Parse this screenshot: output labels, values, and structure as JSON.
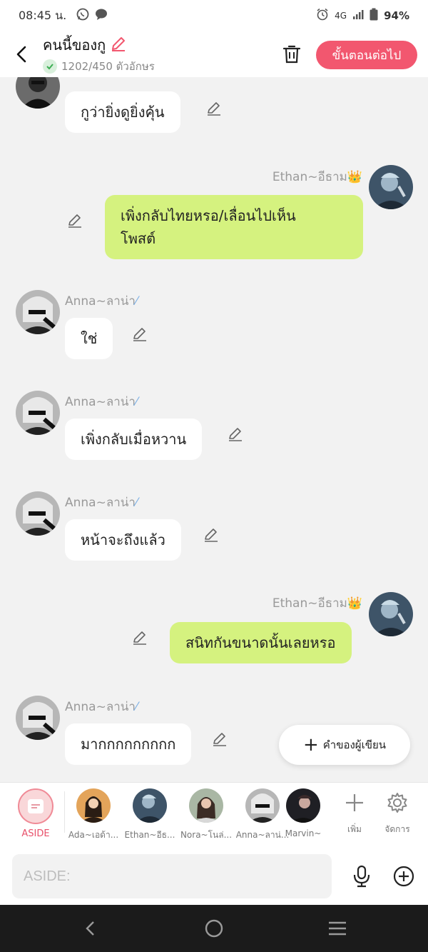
{
  "status_bar": {
    "time": "08:45 น.",
    "network": "4G",
    "battery": "94%"
  },
  "header": {
    "title": "คนนี้ของกู",
    "counter": "1202/450 ตัวอักษร",
    "next_label": "ขั้นตอนต่อไป"
  },
  "messages": [
    {
      "text": "กูว่ายิ่งดูยิ่งคุ้น"
    },
    {
      "sender": "Ethan~อีธาม👑",
      "text": "เพิ่งกลับไทยหรอ/เลื่อนไปเห็น\nโพสต์"
    },
    {
      "sender": "Anna~ลาน่า",
      "text": "ใช่"
    },
    {
      "sender": "Anna~ลาน่า",
      "text": "เพิ่งกลับเมื่อหวาน"
    },
    {
      "sender": "Anna~ลาน่า",
      "text": "หน้าจะถึงแล้ว"
    },
    {
      "sender": "Ethan~อีธาม👑",
      "text": "สนิทกันขนาดนั้นเลยหรอ"
    },
    {
      "sender": "Anna~ลาน่า",
      "text": "มากกกกกกกกก"
    }
  ],
  "writer_button": {
    "label": "คำของผู้เขียน"
  },
  "characters": [
    {
      "name": "ASIDE"
    },
    {
      "name": "Ada~เอด้า..."
    },
    {
      "name": "Ethan~อีธ..."
    },
    {
      "name": "Nora~โนล่..."
    },
    {
      "name": "Anna~ลาน่..."
    },
    {
      "name": "Marvin~"
    }
  ],
  "tools": {
    "add_label": "เพิ่ม",
    "manage_label": "จัดการ"
  },
  "input": {
    "placeholder": "ASIDE:"
  },
  "colors": {
    "accent": "#f2576f",
    "bubble_right": "#d5f27f",
    "bubble_left": "#ffffff"
  }
}
